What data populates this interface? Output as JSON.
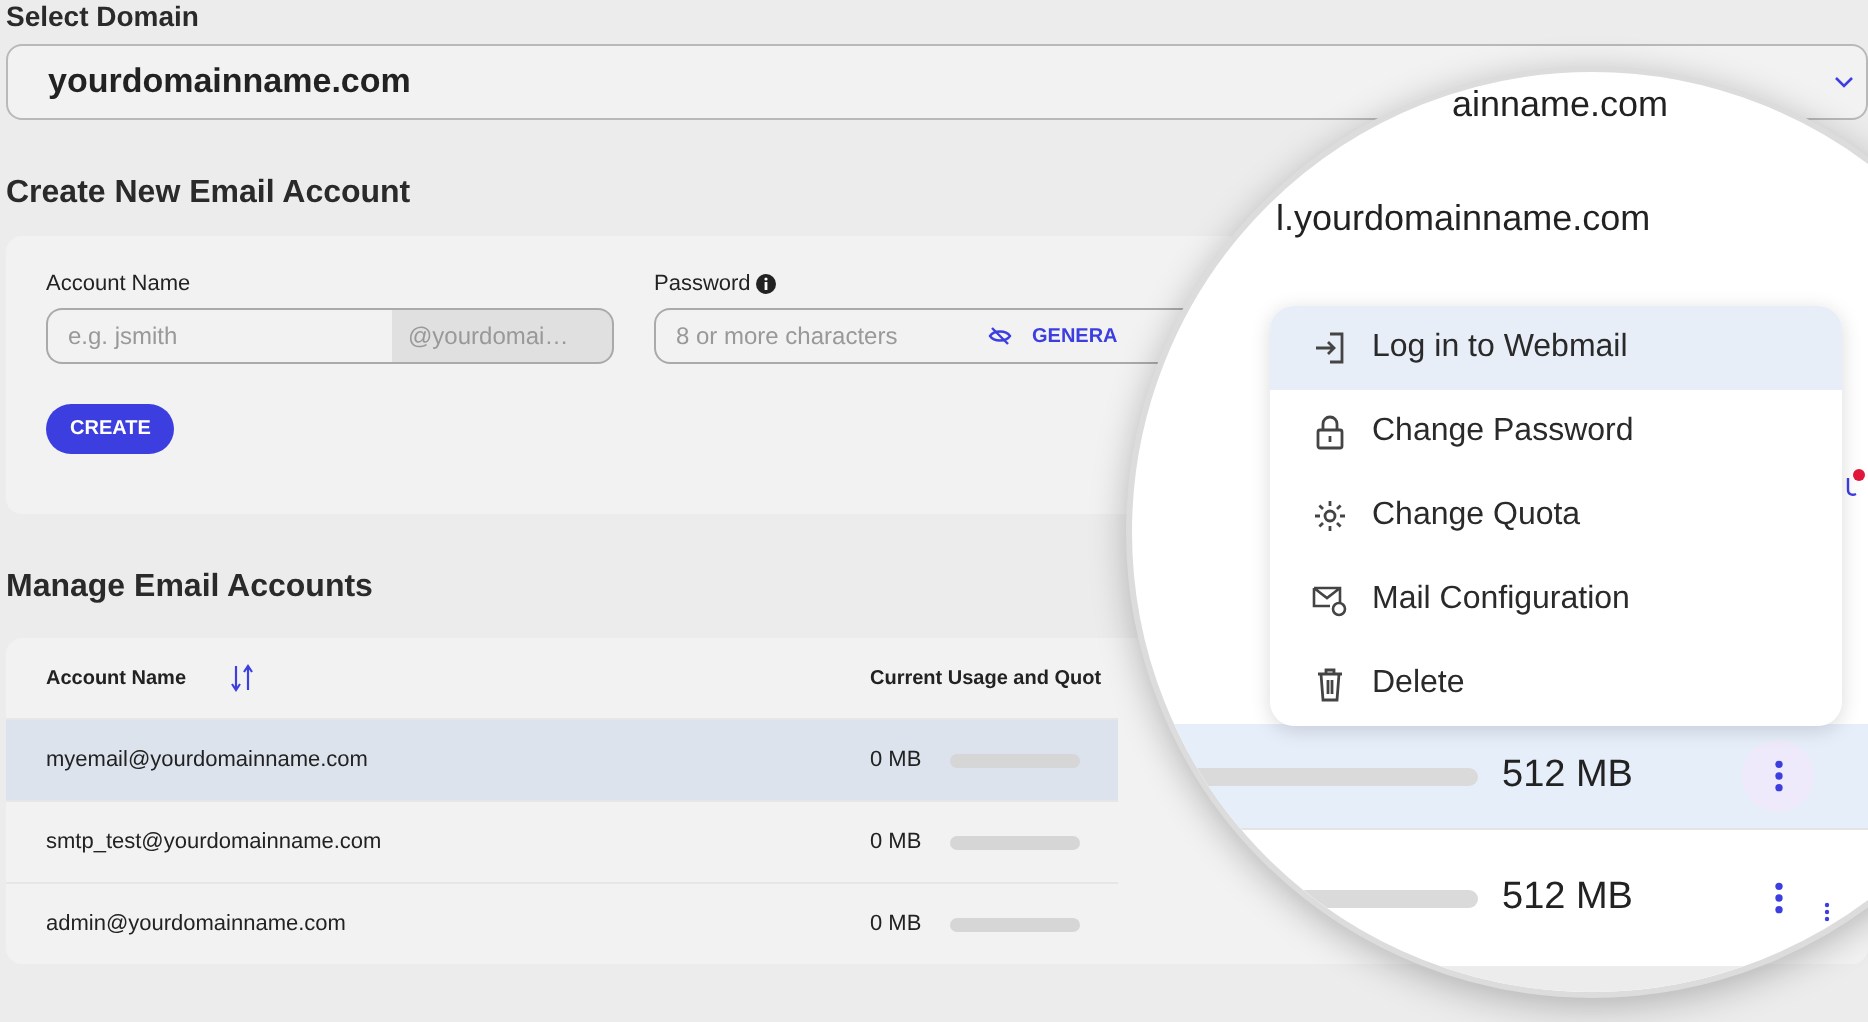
{
  "domain_select": {
    "label": "Select Domain",
    "value": "yourdomainname.com"
  },
  "create_account": {
    "title": "Create New Email Account",
    "account_name": {
      "label": "Account Name",
      "placeholder": "e.g. jsmith",
      "suffix": "@yourdomai…"
    },
    "password": {
      "label": "Password",
      "placeholder": "8 or more characters",
      "generate_button": "GENERA"
    },
    "create_button": "CREATE"
  },
  "manage_accounts": {
    "title": "Manage Email Accounts",
    "columns": [
      "Account Name",
      "Current Usage and Quot"
    ],
    "rows": [
      {
        "account": "myemail@yourdomainname.com",
        "usage": "0 MB",
        "selected": true
      },
      {
        "account": "smtp_test@yourdomainname.com",
        "usage": "0 MB",
        "selected": false
      },
      {
        "account": "admin@yourdomainname.com",
        "usage": "0 MB",
        "selected": false
      }
    ]
  },
  "magnifier": {
    "domain_fragment": "ainname.com",
    "mail_fragment": "l.yourdomainname.com",
    "menu": [
      {
        "label": "Log in to Webmail",
        "kind": "login",
        "selected": true
      },
      {
        "label": "Change Password",
        "kind": "lock",
        "selected": false
      },
      {
        "label": "Change Quota",
        "kind": "gear",
        "selected": false
      },
      {
        "label": "Mail Configuration",
        "kind": "mail",
        "selected": false
      },
      {
        "label": "Delete",
        "kind": "trash",
        "selected": false
      }
    ],
    "rows": [
      {
        "quota": "512 MB",
        "selected": true
      },
      {
        "quota": "512 MB",
        "selected": false
      }
    ]
  }
}
